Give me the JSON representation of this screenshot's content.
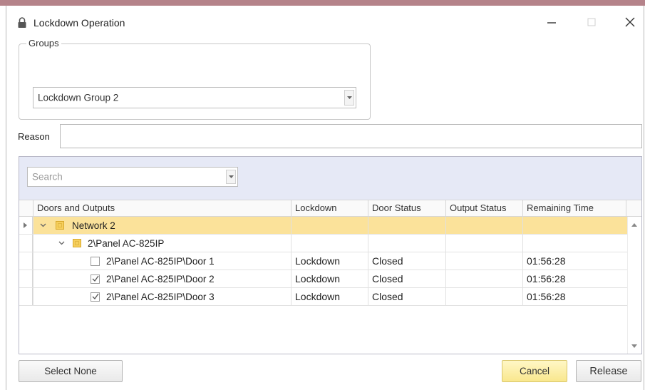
{
  "window": {
    "title": "Lockdown Operation"
  },
  "groups": {
    "legend": "Groups",
    "selected": "Lockdown Group 2"
  },
  "reason": {
    "label": "Reason",
    "value": ""
  },
  "search": {
    "placeholder": "Search"
  },
  "grid": {
    "columns": [
      "Doors and Outputs",
      "Lockdown",
      "Door Status",
      "Output Status",
      "Remaining Time"
    ],
    "rows": [
      {
        "label": "Network 2",
        "lockdown": "",
        "door_status": "",
        "output_status": "",
        "remaining": ""
      },
      {
        "label": "2\\Panel  AC-825IP",
        "lockdown": "",
        "door_status": "",
        "output_status": "",
        "remaining": ""
      },
      {
        "label": "2\\Panel  AC-825IP\\Door 1",
        "checked": false,
        "lockdown": "Lockdown",
        "door_status": "Closed",
        "output_status": "",
        "remaining": "01:56:28"
      },
      {
        "label": "2\\Panel  AC-825IP\\Door 2",
        "checked": true,
        "lockdown": "Lockdown",
        "door_status": "Closed",
        "output_status": "",
        "remaining": "01:56:28"
      },
      {
        "label": "2\\Panel  AC-825IP\\Door 3",
        "checked": true,
        "lockdown": "Lockdown",
        "door_status": "Closed",
        "output_status": "",
        "remaining": "01:56:28"
      }
    ]
  },
  "buttons": {
    "select_none": "Select None",
    "cancel": "Cancel",
    "release": "Release"
  },
  "colors": {
    "network_row": "#fbe29a",
    "cancel_button": "#f9e78d",
    "search_strip": "#e6e9f6"
  }
}
